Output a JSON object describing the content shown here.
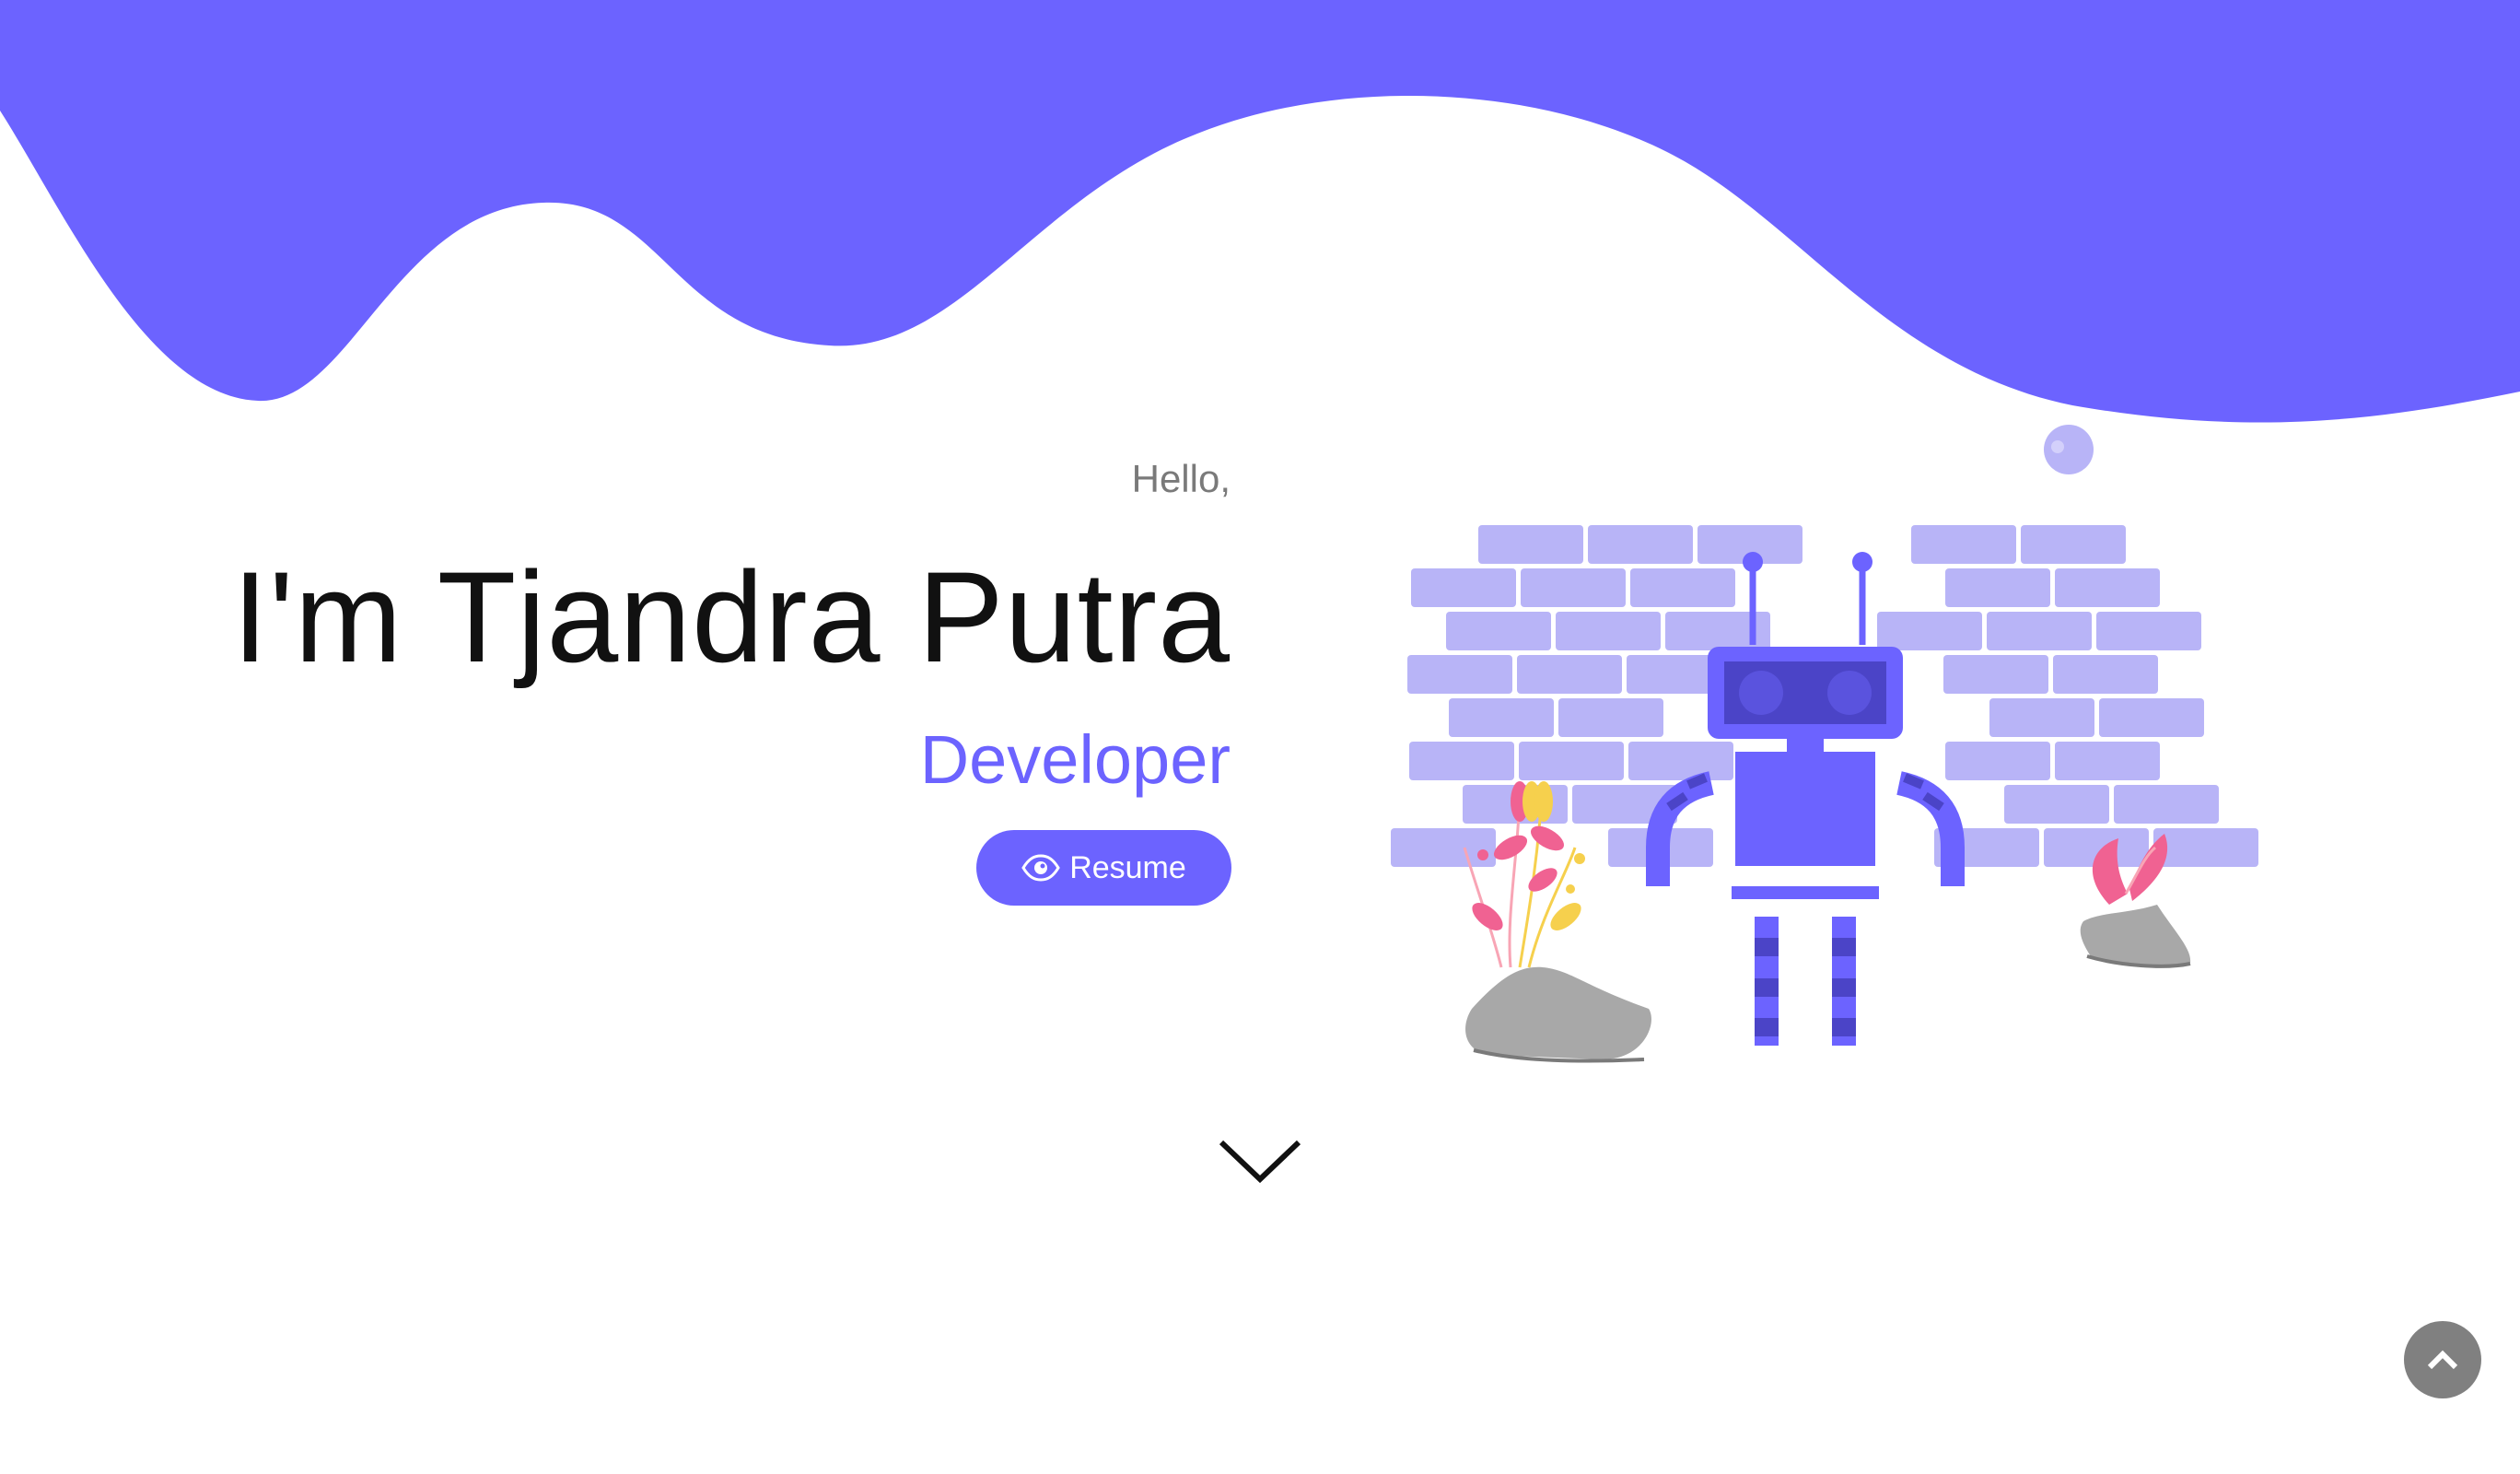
{
  "colors": {
    "accent": "#6c63ff",
    "brick": "#b8b4f7",
    "rock": "#a8a8a8",
    "scroll_top_bg": "#808080"
  },
  "hero": {
    "greeting": "Hello,",
    "name": "I'm Tjandra Putra",
    "role": "Developer",
    "resume_label": "Resume",
    "resume_icon": "eye-icon"
  },
  "illustration": {
    "subject": "robot-icon"
  },
  "navigation": {
    "scroll_down_icon": "chevron-down-icon",
    "scroll_top_icon": "chevron-up-icon"
  }
}
